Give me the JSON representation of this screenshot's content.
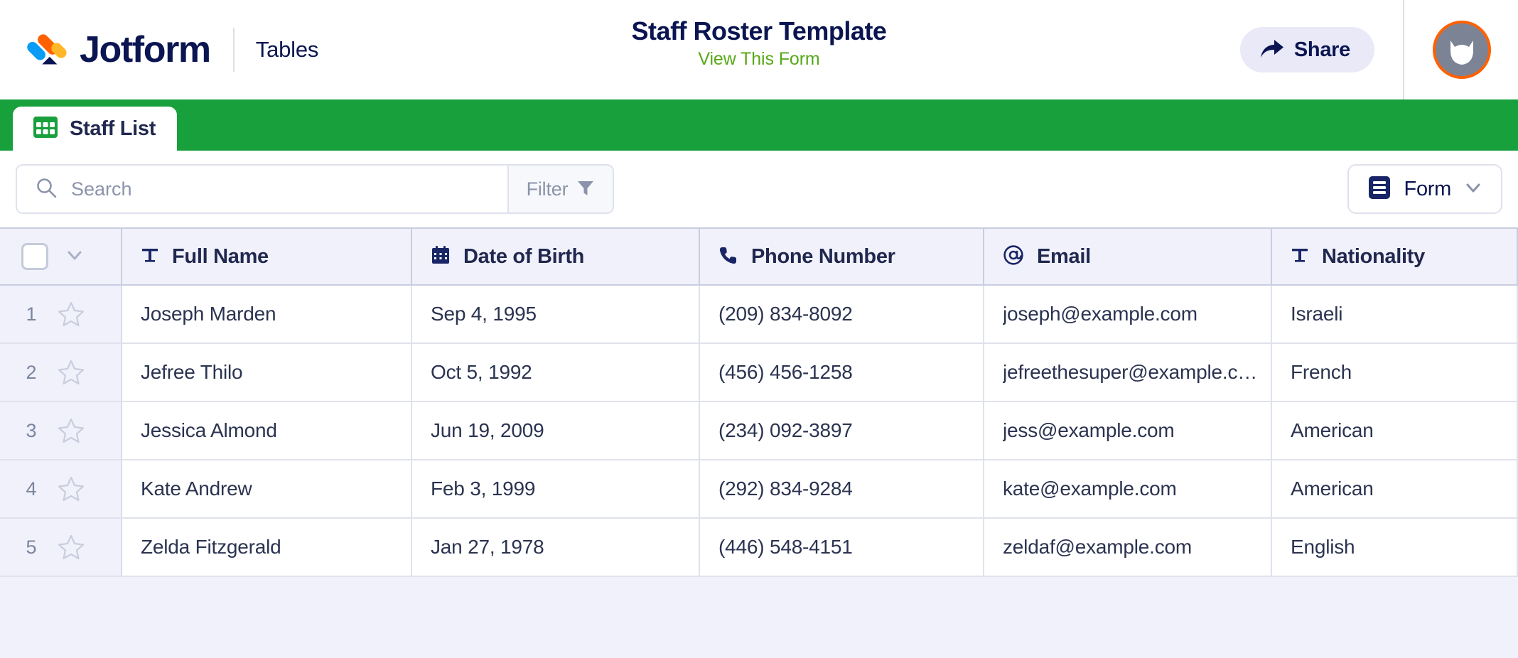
{
  "header": {
    "brand_name": "Jotform",
    "product_label": "Tables",
    "form_title": "Staff Roster Template",
    "view_form_link": "View This Form",
    "share_label": "Share",
    "logo_colors": {
      "blue": "#0a9cf5",
      "orange": "#ff6100",
      "yellow": "#ffb629",
      "navy": "#0a1551"
    },
    "avatar_ring_color": "#ff6100",
    "avatar_bg_color": "#7c8395"
  },
  "tabs": [
    {
      "label": "Staff List",
      "icon": "grid-icon",
      "active": true
    }
  ],
  "tabbar": {
    "accent_color": "#18a03c"
  },
  "toolbar": {
    "search_value": "",
    "search_placeholder": "Search",
    "search_icon": "search-icon",
    "filter_label": "Filter",
    "filter_icon": "funnel-icon",
    "form_label": "Form",
    "form_icon": "form-icon",
    "chevron_icon": "chevron-down-icon"
  },
  "table": {
    "columns": [
      {
        "label": "Full Name",
        "icon": "text-field-icon"
      },
      {
        "label": "Date of Birth",
        "icon": "calendar-icon"
      },
      {
        "label": "Phone Number",
        "icon": "phone-icon"
      },
      {
        "label": "Email",
        "icon": "at-sign-icon"
      },
      {
        "label": "Nationality",
        "icon": "text-field-icon"
      }
    ],
    "rows": [
      {
        "number": "1",
        "full_name": "Joseph Marden",
        "date_of_birth": "Sep 4, 1995",
        "phone_number": "(209) 834-8092",
        "email": "joseph@example.com",
        "nationality": "Israeli"
      },
      {
        "number": "2",
        "full_name": "Jefree Thilo",
        "date_of_birth": "Oct 5, 1992",
        "phone_number": "(456) 456-1258",
        "email": "jefreethesuper@example.c…",
        "nationality": "French"
      },
      {
        "number": "3",
        "full_name": "Jessica Almond",
        "date_of_birth": "Jun 19, 2009",
        "phone_number": "(234) 092-3897",
        "email": "jess@example.com",
        "nationality": "American"
      },
      {
        "number": "4",
        "full_name": "Kate Andrew",
        "date_of_birth": "Feb 3, 1999",
        "phone_number": "(292) 834-9284",
        "email": "kate@example.com",
        "nationality": "American"
      },
      {
        "number": "5",
        "full_name": "Zelda Fitzgerald",
        "date_of_birth": "Jan 27, 1978",
        "phone_number": "(446) 548-4151",
        "email": "zeldaf@example.com",
        "nationality": "English"
      }
    ]
  }
}
